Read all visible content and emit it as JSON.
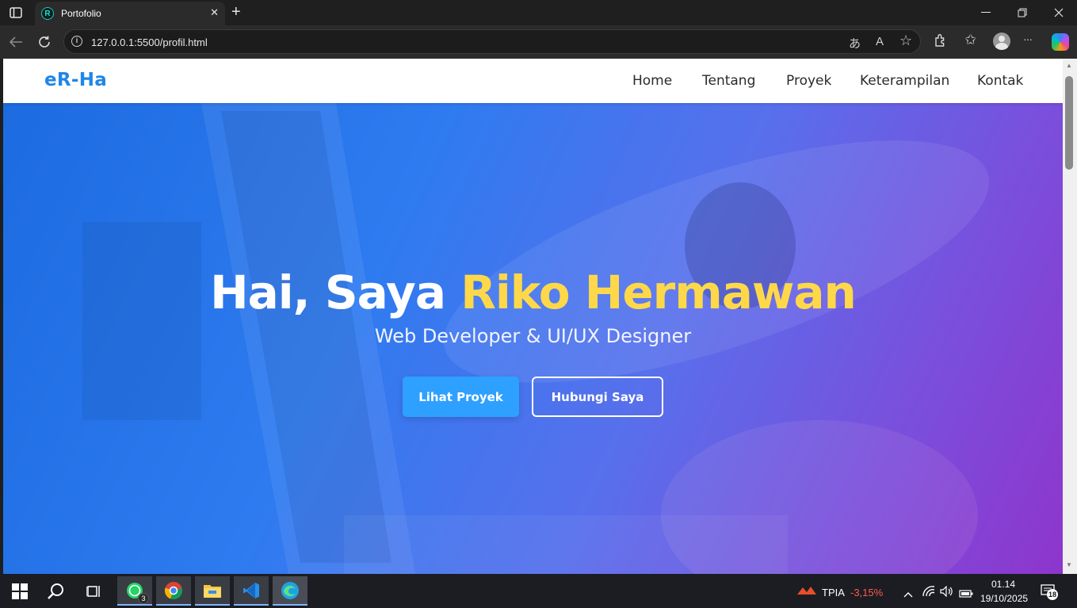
{
  "browser": {
    "tab_title": "Portofolio",
    "tab_close": "✕",
    "new_tab": "+",
    "url": "127.0.0.1:5500/profil.html",
    "window_controls": {
      "minimize": "—",
      "restore": "❐",
      "close": "✕"
    },
    "icons": [
      "tab-actions-icon",
      "back-icon",
      "reload-icon",
      "site-info-icon",
      "translate-icon",
      "read-aloud-icon",
      "favorite-icon",
      "extensions-icon",
      "favorites-icon",
      "profile-icon",
      "more-icon",
      "copilot-icon"
    ],
    "toolbar": {
      "translate": "あ",
      "read_aloud": "A",
      "favorite": "☆",
      "extensions": "⧉",
      "favorites": "✩",
      "more": "···"
    }
  },
  "site": {
    "logo": "eR-Ha",
    "nav": [
      {
        "label": "Home"
      },
      {
        "label": "Tentang"
      },
      {
        "label": "Proyek"
      },
      {
        "label": "Keterampilan"
      },
      {
        "label": "Kontak"
      }
    ],
    "hero": {
      "greeting": "Hai, Saya ",
      "name": "Riko Hermawan",
      "subtitle": "Web Developer & UI/UX Designer",
      "primary_button": "Lihat Proyek",
      "secondary_button": "Hubungi Saya"
    },
    "colors": {
      "brand": "#1f86e8",
      "accent": "#ffd84a",
      "button": "#2ea0ff"
    }
  },
  "taskbar": {
    "apps": [
      "windows-start-icon",
      "search-icon",
      "task-view-icon",
      "whatsapp-icon",
      "chrome-icon",
      "file-explorer-icon",
      "vscode-icon",
      "edge-icon"
    ],
    "whatsapp_badge": "3",
    "stock": {
      "ticker": "TPIA",
      "change": "-3,15%",
      "change_color": "#ff5a4d"
    },
    "time": "01.14",
    "date": "19/10/2025",
    "notification_count": "18"
  }
}
